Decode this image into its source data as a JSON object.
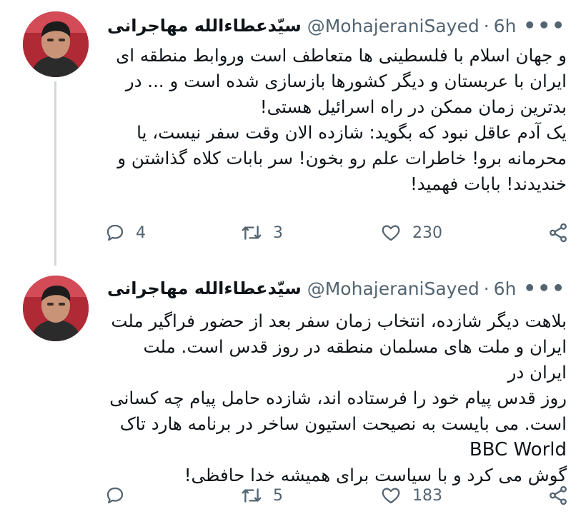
{
  "tweets": [
    {
      "author_name": "سیّدعطاءالله مهاجرانی",
      "handle": "@MohajeraniSayed",
      "separator": "·",
      "time": "6h",
      "lines": [
        "و جهان اسلام با فلسطینی ها متعاطف است وروابط منطقه ای",
        "ایران با عربستان و دیگر کشورها بازسازی شده است و ... در",
        "بدترین زمان ممکن در راه اسرائیل هستی!",
        "یک آدم عاقل نبود که بگوید: شازده الان وقت سفر نیست، یا",
        "محرمانه برو!  خاطرات علم رو بخون! سر بابات کلاه گذاشتن و",
        "خندیدند! بابات فهمید!"
      ],
      "replies": "4",
      "retweets": "3",
      "likes": "230"
    },
    {
      "author_name": "سیّدعطاءالله مهاجرانی",
      "handle": "@MohajeraniSayed",
      "separator": "·",
      "time": "6h",
      "lines": [
        "بلاهت دیگر شازده، انتخاب زمان سفر بعد از حضور فراگیر ملت",
        "ایران و ملت های مسلمان منطقه در روز قدس است. ملت ایران در",
        "روز قدس پیام خود را فرستاده اند، شازده حامل پیام چه کسانی",
        "است. می بایست به نصیحت استیون ساخر در برنامه هارد تاک",
        "BBC World",
        "گوش می کرد و با سیاست برای همیشه خدا حافظی!"
      ],
      "replies": "",
      "retweets": "5",
      "likes": "183"
    }
  ],
  "colors": {
    "text": "#0f1419",
    "secondary": "#536471",
    "thread_line": "#cfd9de",
    "avatar_bg": "#b02a36"
  },
  "icons": {
    "more": "more-dots-icon",
    "reply": "reply-icon",
    "retweet": "retweet-icon",
    "like": "heart-icon",
    "share": "share-icon"
  }
}
